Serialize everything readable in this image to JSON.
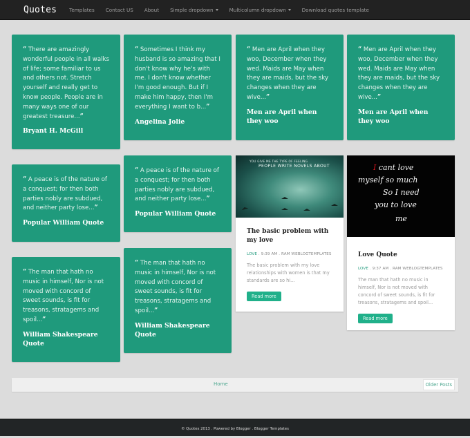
{
  "navbar": {
    "brand": "Quotes",
    "items": [
      {
        "label": "Templates",
        "dropdown": false
      },
      {
        "label": "Contact US",
        "dropdown": false
      },
      {
        "label": "About",
        "dropdown": false
      },
      {
        "label": "Simple dropdown",
        "dropdown": true
      },
      {
        "label": "Multicolumn dropdown",
        "dropdown": true
      },
      {
        "label": "Download quotes template",
        "dropdown": false
      }
    ]
  },
  "quote_cards": [
    {
      "text": "There are amazingly wonderful people in all walks of life; some familiar to us and others not. Stretch yourself and really get to know people. People are in many ways one of our greatest treasure...",
      "author": "Bryant H. McGill"
    },
    {
      "text": "Sometimes I think my husband is so amazing that I don't know why he's with me. I don't know whether I'm good enough. But if I make him happy, then I'm everything I want to b...",
      "author": "Angelina Jolie"
    },
    {
      "text": "Men are April when they woo, December when they wed. Maids are May when they are maids, but the sky changes when they are wive...",
      "author": "Men are April when they woo"
    },
    {
      "text": "Men are April when they woo, December when they wed. Maids are May when they are maids, but the sky changes when they are wive...",
      "author": "Men are April when they woo"
    },
    {
      "text": "A peace is of the nature of a conquest; for then both parties nobly are subdued, and neither party lose...",
      "author": "Popular William Quote"
    },
    {
      "text": "A peace is of the nature of a conquest; for then both parties nobly are subdued, and neither party lose...",
      "author": "Popular William Quote"
    },
    {
      "text": "The man that hath no music in himself, Nor is not moved with concord of sweet sounds, is fit for treasons, stratagems and spoil...",
      "author": "William Shakespeare Quote"
    },
    {
      "text": "The man that hath no music in himself, Nor is not moved with concord of sweet sounds, is fit for treasons, stratagems and spoil...",
      "author": "William Shakespeare Quote"
    }
  ],
  "quote_marks": {
    "open": "“",
    "close": "”"
  },
  "posts": [
    {
      "image_text_small": "YOU GIVE ME THE TYPE OF FEELING",
      "image_text_big": "PEOPLE WRITE NOVELS ABOUT",
      "title": "The basic problem with my love",
      "category": "LOVE",
      "meta": " . 9:39 AM . RAM WEBLOGTEMPLATES",
      "excerpt": "The basic problem with my love relationships with women is that my standards are so hi...",
      "button": "Read more"
    },
    {
      "image_lines": [
        "cant love",
        "myself so much",
        "So I need",
        "you to love",
        "me"
      ],
      "image_first_letter": "I",
      "title": "Love Quote",
      "category": "LOVE",
      "meta": " . 9:37 AM . RAM WEBLOGTEMPLATES",
      "excerpt": "The man that hath no music in himself, Nor is not moved with concord of sweet sounds, is fit for treasons, stratagems and spoil...",
      "button": "Read more"
    }
  ],
  "pager": {
    "home": "Home",
    "older": "Older Posts"
  },
  "footer": {
    "text": "© Quotes 2013 . Powered by Blogger . Blogger Templates"
  },
  "colors": {
    "accent": "#1f9a7c",
    "button": "#20b08a",
    "navbar": "#222222",
    "background": "#dcdcdc"
  }
}
